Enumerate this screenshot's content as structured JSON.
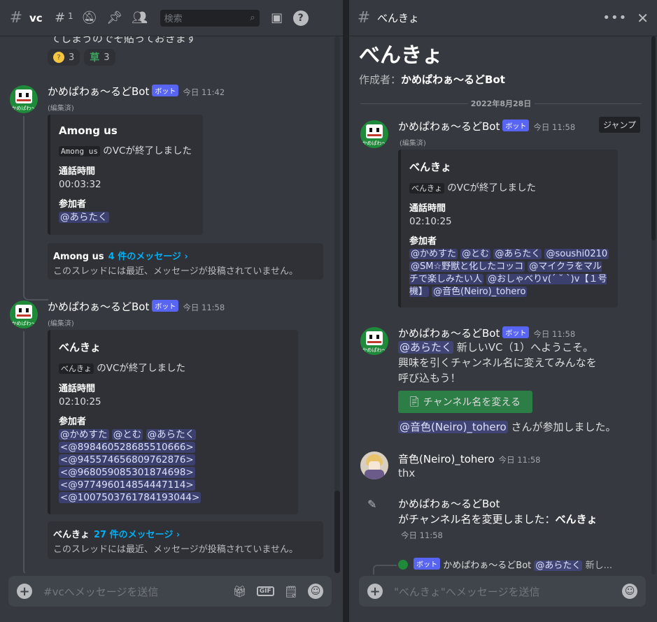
{
  "left": {
    "channel": "vc",
    "threads_count": "1",
    "search_placeholder": "検索",
    "cut_line": "てしまうのでそ貼っておきます",
    "reactions": [
      {
        "count": "3"
      },
      {
        "emoji": "草",
        "count": "3"
      }
    ],
    "avatar_text": "かめぱわ〜",
    "messages": [
      {
        "user": "かめぱわぁ～るどBot",
        "badge": "ボット",
        "time": "今日 11:42",
        "edited": "(編集済)",
        "embed": {
          "title": "Among us",
          "code": "Among us",
          "desc_suffix": "のVCが終了しました",
          "field1_name": "通話時間",
          "field1_val": "00:03:32",
          "field2_name": "参加者",
          "mentions": [
            "@あらたく"
          ]
        },
        "thread": {
          "name": "Among us",
          "link": "4 件のメッセージ ›",
          "sub": "このスレッドには最近、メッセージが投稿されていません。"
        }
      },
      {
        "user": "かめぱわぁ～るどBot",
        "badge": "ボット",
        "time": "今日 11:58",
        "edited": "(編集済)",
        "embed": {
          "title": "べんきょ",
          "code": "べんきょ",
          "desc_suffix": "のVCが終了しました",
          "field1_name": "通話時間",
          "field1_val": "02:10:25",
          "field2_name": "参加者",
          "mentions": [
            "@かめすた",
            "@とむ",
            "@あらたく",
            "<@898460528685510666>",
            "<@945574656809762876>",
            "<@968059085301874698>",
            "<@977496014854447114>",
            "<@1007503761784193044>"
          ]
        },
        "thread": {
          "name": "べんきょ",
          "link": "27 件のメッセージ ›",
          "sub": "このスレッドには最近、メッセージが投稿されていません。"
        }
      }
    ],
    "composer_placeholder": "#vcへメッセージを送信"
  },
  "right": {
    "header_title": "べんきょ",
    "big_title": "べんきょ",
    "creator_label": "作成者：",
    "creator_name": "かめぱわぁ～るどBot",
    "date": "2022年8月28日",
    "jump": "ジャンプ",
    "msg1": {
      "user": "かめぱわぁ～るどBot",
      "badge": "ボット",
      "time": "今日 11:58",
      "edited": "(編集済)",
      "embed": {
        "title": "べんきょ",
        "code": "べんきょ",
        "desc_suffix": "のVCが終了しました",
        "field1_name": "通話時間",
        "field1_val": "02:10:25",
        "field2_name": "参加者",
        "mentions": [
          "@かめすた",
          "@とむ",
          "@あらたく",
          "@soushi0210",
          "@SM☆野獣と化したコッコ",
          "@マイクラをマルチで楽しみたい人",
          "@おしゃべりv(´ ˘ `)v【１号機】",
          "@音色(Neiro)_tohero"
        ]
      }
    },
    "msg2": {
      "user": "かめぱわぁ～るどBot",
      "badge": "ボット",
      "time": "今日 11:58",
      "mention": "@あらたく",
      "text1": "新しいVC（1）へようこそ。",
      "text2": "興味を引くチャンネル名に変えてみんなを",
      "text3": "呼び込もう！",
      "button": "チャンネル名を変える",
      "join_mention": "@音色(Neiro)_tohero",
      "join_text": "さんが参加しました。"
    },
    "msg3": {
      "user": "音色(Neiro)_tohero",
      "time": "今日 11:58",
      "text": "thx"
    },
    "msg4": {
      "line1": "かめぱわぁ～るどBot",
      "line2_prefix": "がチャンネル名を変更しました：",
      "line2_name": "べんきょ",
      "time": "今日 11:58"
    },
    "reply": {
      "badge": "ボット",
      "user": "かめぱわぁ～るどBot",
      "mention": "@あらたく",
      "text": "新し..."
    },
    "composer_placeholder": "\"べんきょ\"へメッセージを送信"
  }
}
